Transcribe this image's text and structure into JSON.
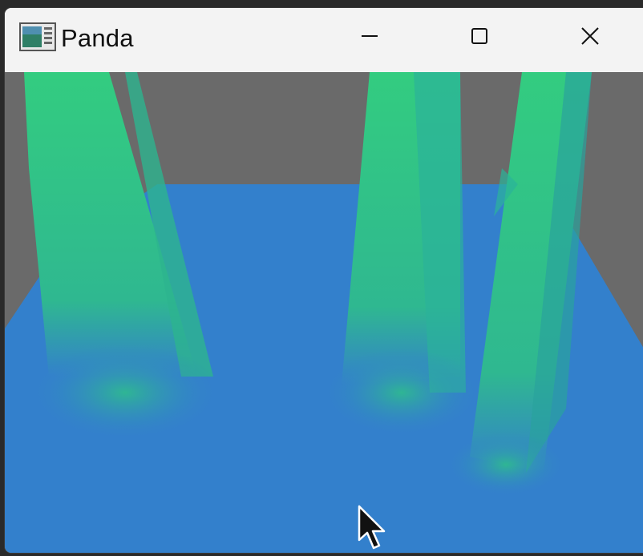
{
  "window": {
    "title": "Panda"
  },
  "titlebar": {
    "app_icon": "panda-app-icon",
    "buttons": [
      {
        "name": "minimize",
        "icon": "minimize-icon"
      },
      {
        "name": "maximize",
        "icon": "maximize-icon"
      },
      {
        "name": "close",
        "icon": "close-icon"
      }
    ]
  },
  "scene": {
    "background_color": "#6a6a6a",
    "floor_color": "#3380cc",
    "surface_color": "#2ecc80"
  },
  "cursor": {
    "icon": "arrow-cursor-icon"
  }
}
